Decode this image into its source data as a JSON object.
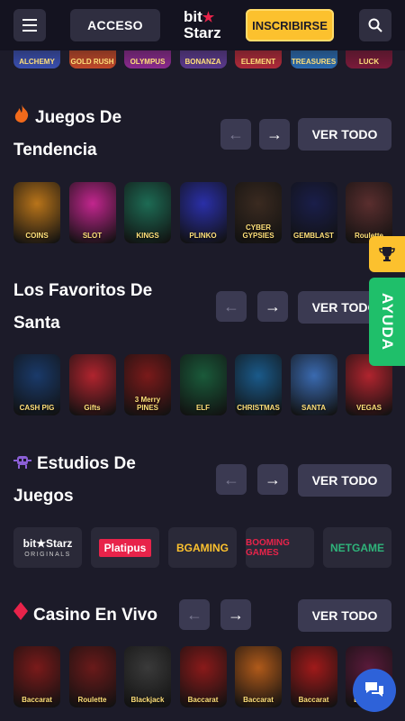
{
  "header": {
    "login_label": "ACCESO",
    "logo_top": "bit",
    "logo_bottom": "Starz",
    "signup_label": "INSCRIBIRSE",
    "menu_icon": "hamburger-icon",
    "search_icon": "search-icon"
  },
  "top_strip": [
    {
      "label": "ALCHEMY",
      "color": "#3a4fb0"
    },
    {
      "label": "GOLD RUSH",
      "color": "#c0482a"
    },
    {
      "label": "OLYMPUS",
      "color": "#8a2a8e"
    },
    {
      "label": "BONANZA",
      "color": "#5b3a8e"
    },
    {
      "label": "ELEMENT",
      "color": "#b02a3a"
    },
    {
      "label": "TREASURES",
      "color": "#2a6ab0"
    },
    {
      "label": "LUCK",
      "color": "#7a1a3a"
    }
  ],
  "view_all_label": "VER TODO",
  "sections": {
    "trending": {
      "title_line1": "Juegos De",
      "title_line2": "Tendencia",
      "icon": "fire-icon",
      "games": [
        {
          "label": "COINS",
          "color": "#b8741a"
        },
        {
          "label": "SLOT",
          "color": "#c2268e"
        },
        {
          "label": "KINGS",
          "color": "#1d6b54"
        },
        {
          "label": "PLINKO",
          "color": "#2a2fa8"
        },
        {
          "label": "CYBER GYPSIES",
          "color": "#3a2a20"
        },
        {
          "label": "GEMBLAST",
          "color": "#1a1e4a"
        },
        {
          "label": "Roulette",
          "color": "#5a2e2e"
        }
      ]
    },
    "santa": {
      "title_line1": "Los Favoritos De",
      "title_line2": "Santa",
      "games": [
        {
          "label": "CASH PIG",
          "color": "#1a3a6a"
        },
        {
          "label": "Gifts",
          "color": "#b0242e"
        },
        {
          "label": "3 Merry PINES",
          "color": "#7a1a1a"
        },
        {
          "label": "ELF",
          "color": "#1a5a3a"
        },
        {
          "label": "CHRISTMAS",
          "color": "#1a5a8a"
        },
        {
          "label": "SANTA",
          "color": "#3a6ab0"
        },
        {
          "label": "VEGAS",
          "color": "#b0242e"
        }
      ]
    },
    "studios": {
      "title_line1": "Estudios De",
      "title_line2": "Juegos",
      "icon": "alien-icon",
      "items": [
        {
          "name": "bit★Starz",
          "sub": "ORIGINALS"
        },
        {
          "name": "Platipus",
          "sub": ""
        },
        {
          "name": "BGAMING",
          "sub": ""
        },
        {
          "name": "BOOMING GAMES",
          "sub": ""
        },
        {
          "name": "NETGAME",
          "sub": ""
        }
      ]
    },
    "live": {
      "title": "Casino En Vivo",
      "icon": "diamond-icon",
      "games": [
        {
          "label": "Baccarat",
          "color": "#7a1a1a"
        },
        {
          "label": "Roulette",
          "color": "#6a1a1a"
        },
        {
          "label": "Blackjack",
          "color": "#3a3a3a"
        },
        {
          "label": "Baccarat",
          "color": "#8a1a1a"
        },
        {
          "label": "Baccarat",
          "color": "#b05a1a"
        },
        {
          "label": "Baccarat",
          "color": "#a01a1a"
        },
        {
          "label": "Baccarat",
          "color": "#5a1a3a"
        }
      ]
    }
  },
  "side": {
    "trophy_icon": "trophy-icon",
    "help_label": "AYUDA",
    "chat_icon": "chat-icon"
  }
}
